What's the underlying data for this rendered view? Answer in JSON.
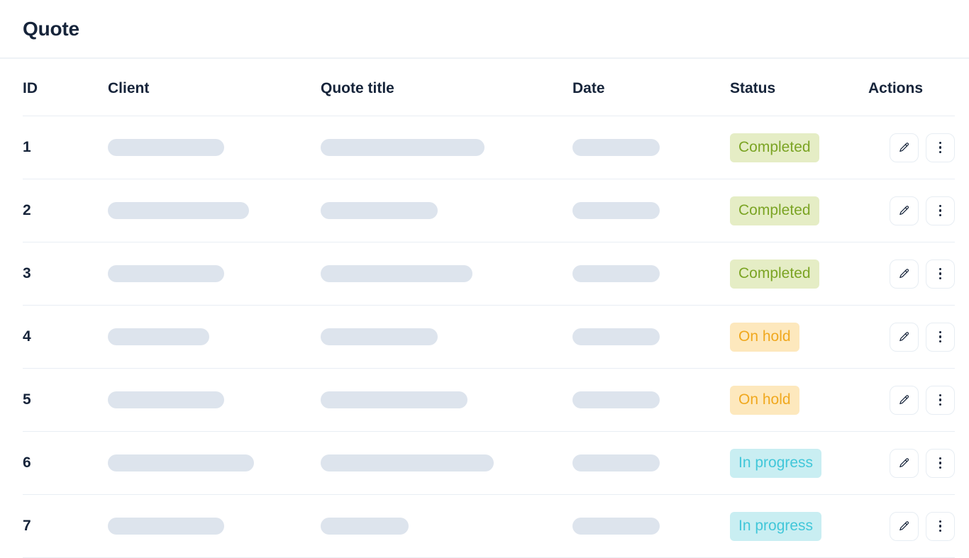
{
  "header": {
    "title": "Quote"
  },
  "table": {
    "columns": [
      {
        "key": "id",
        "label": "ID"
      },
      {
        "key": "client",
        "label": "Client"
      },
      {
        "key": "title",
        "label": "Quote title"
      },
      {
        "key": "date",
        "label": "Date"
      },
      {
        "key": "status",
        "label": "Status"
      },
      {
        "key": "actions",
        "label": "Actions"
      }
    ],
    "rows": [
      {
        "id": "1",
        "client_width": 164,
        "title_width": 231,
        "date_width": 123,
        "status": "Completed",
        "status_type": "completed"
      },
      {
        "id": "2",
        "client_width": 199,
        "title_width": 165,
        "date_width": 123,
        "status": "Completed",
        "status_type": "completed"
      },
      {
        "id": "3",
        "client_width": 164,
        "title_width": 214,
        "date_width": 123,
        "status": "Completed",
        "status_type": "completed"
      },
      {
        "id": "4",
        "client_width": 143,
        "title_width": 165,
        "date_width": 123,
        "status": "On hold",
        "status_type": "onhold"
      },
      {
        "id": "5",
        "client_width": 164,
        "title_width": 207,
        "date_width": 123,
        "status": "On hold",
        "status_type": "onhold"
      },
      {
        "id": "6",
        "client_width": 206,
        "title_width": 244,
        "date_width": 123,
        "status": "In progress",
        "status_type": "inprogress"
      },
      {
        "id": "7",
        "client_width": 164,
        "title_width": 124,
        "date_width": 123,
        "status": "In progress",
        "status_type": "inprogress"
      }
    ],
    "row_actions": [
      {
        "name": "edit-row-button",
        "icon": "pencil-icon"
      },
      {
        "name": "row-overflow-button",
        "icon": "vertical-dots-icon"
      }
    ]
  },
  "colors": {
    "text_primary": "#16243a",
    "skeleton": "#dde4ed",
    "divider": "#e9eef4",
    "completed_bg": "#e5edc5",
    "completed_fg": "#7ba424",
    "onhold_bg": "#fde8bd",
    "onhold_fg": "#f0a81e",
    "inprogress_bg": "#c9eef2",
    "inprogress_fg": "#41c7d9"
  }
}
